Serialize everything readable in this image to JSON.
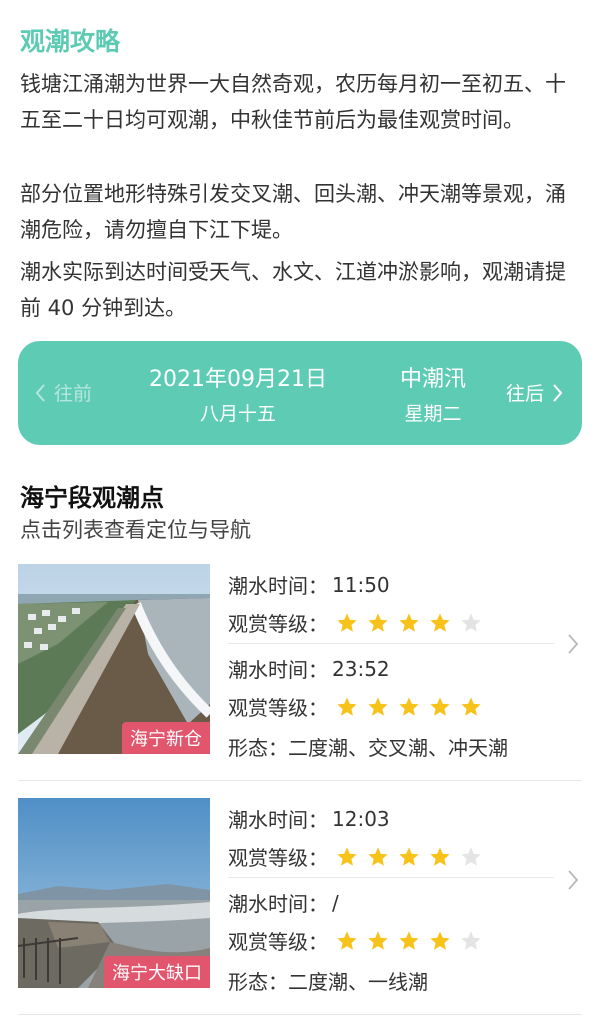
{
  "guide": {
    "title": "观潮攻略",
    "p1": "钱塘江涌潮为世界一大自然奇观，农历每月初一至初五、十五至二十日均可观潮，中秋佳节前后为最佳观赏时间。",
    "p2": "部分位置地形特殊引发交叉潮、回头潮、冲天潮等景观，涌潮危险，请勿擅自下江下堤。",
    "p3": "潮水实际到达时间受天气、水文、江道冲淤影响，观潮请提前 40 分钟到达。"
  },
  "date_bar": {
    "prev_label": "往前",
    "next_label": "往后",
    "date": "2021年09月21日",
    "lunar": "八月十五",
    "tide_type": "中潮汛",
    "weekday": "星期二"
  },
  "section": {
    "title": "海宁段观潮点",
    "subtitle": "点击列表查看定位与导航"
  },
  "spots": [
    {
      "name": "海宁新仓",
      "tide_time_label": "潮水时间：",
      "rating_label": "观赏等级：",
      "form_label": "形态：",
      "tides": [
        {
          "time": "11:50",
          "rating": 4
        },
        {
          "time": "23:52",
          "rating": 5
        }
      ],
      "form": "二度潮、交叉潮、冲天潮"
    },
    {
      "name": "海宁大缺口",
      "tide_time_label": "潮水时间：",
      "rating_label": "观赏等级：",
      "form_label": "形态：",
      "tides": [
        {
          "time": "12:03",
          "rating": 4
        },
        {
          "time": "/",
          "rating": 4
        }
      ],
      "form": "二度潮、一线潮"
    }
  ],
  "colors": {
    "accent": "#5ecbb5",
    "title": "#5dcab4",
    "badge": "#e2566d",
    "star_on": "#f7c21a",
    "star_off": "#e4e4e4"
  }
}
